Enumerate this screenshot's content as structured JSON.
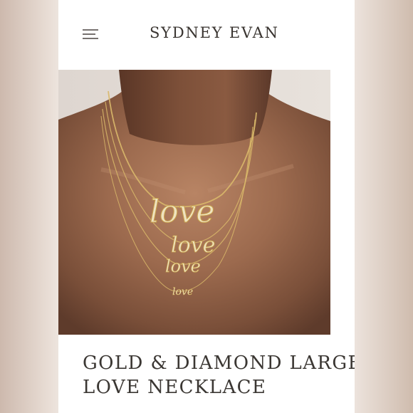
{
  "header": {
    "brand": "SYDNEY EVAN",
    "menu_icon": "hamburger-menu-icon"
  },
  "product": {
    "image_subject": "necklace-model-photo",
    "charm_text": "love",
    "title_line1": "GOLD & DIAMOND LARGE",
    "title_line2": "LOVE NECKLACE"
  },
  "colors": {
    "brand_text": "#3a3531",
    "title_text": "#3b3733",
    "page_background": "#ffffff",
    "side_background": "#f4efeb",
    "gold": "#d9b86a"
  }
}
